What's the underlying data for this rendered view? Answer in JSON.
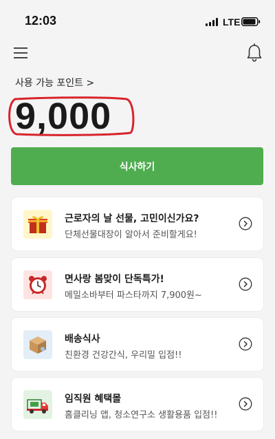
{
  "status_bar": {
    "time": "12:03",
    "network": "LTE"
  },
  "header": {
    "menu_icon": "hamburger-menu-icon",
    "notification_icon": "bell-icon"
  },
  "points": {
    "label": "사용 가능 포인트 >",
    "value": "9,000"
  },
  "primary_action": {
    "label": "식사하기"
  },
  "cards": [
    {
      "title": "근로자의 날 선물, 고민이신가요?",
      "description": "단체선물대장이 알아서 준비할게요!",
      "icon": "gift-box-icon"
    },
    {
      "title": "면사랑 봄맞이 단독특가!",
      "description": "메밀소바부터 파스타까지 7,900원~",
      "icon": "alarm-clock-icon"
    },
    {
      "title": "배송식사",
      "description": "친환경 건강간식, 우리밀 입점!!",
      "icon": "delivery-box-icon"
    },
    {
      "title": "임직원 혜택몰",
      "description": "홈클리닝 앱, 청소연구소 생활용품 입점!!",
      "icon": "delivery-truck-icon"
    }
  ],
  "colors": {
    "accent_green": "#4fad4f",
    "highlight_red": "#d8232a",
    "background": "#f4f4f5"
  }
}
